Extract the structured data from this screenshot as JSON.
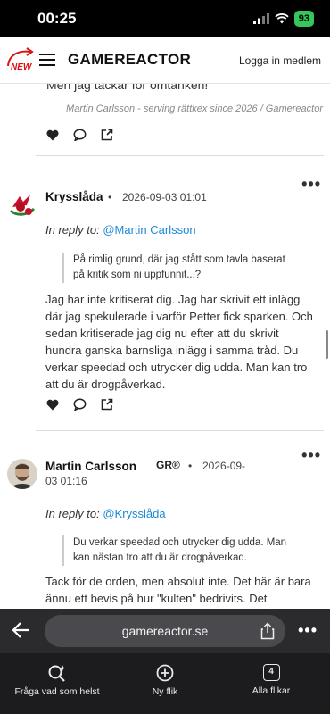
{
  "status_bar": {
    "time": "00:25",
    "battery": "93"
  },
  "header": {
    "badge": "NEW",
    "logo": "GAMEREACTOR",
    "login": "Logga in medlem"
  },
  "prev_post": {
    "partial_text": "Men jag tackar för omtanken!",
    "signature": "Martin Carlsson - serving rättkex since 2026 / Gamereactor"
  },
  "posts": [
    {
      "author": "Krysslåda",
      "separator": "•",
      "datetime": "2026-09-03 01:01",
      "reply_label": "In reply to:",
      "reply_mention": "@Martin Carlsson",
      "quote": "På rimlig grund, där jag stått som tavla baserat på kritik som ni uppfunnit...?",
      "body": "Jag har inte kritiserat dig. Jag har skrivit ett inlägg där jag spekulerade i varför Petter fick sparken. Och sedan kritiserade jag dig nu efter att du skrivit hundra ganska barnsliga inlägg i samma tråd. Du verkar speedad och utrycker dig udda. Man kan tro att du är drogpåverkad."
    },
    {
      "author": "Martin Carlsson",
      "badge": "GR®",
      "separator": "•",
      "datetime_line1": "2026-09-",
      "datetime_line2": "03 01:16",
      "reply_label": "In reply to:",
      "reply_mention": "@Krysslåda",
      "quote": "Du verkar speedad och utrycker dig udda. Man kan nästan tro att du är drogpåverkad.",
      "body": "Tack för de orden, men absolut inte. Det här är bara ännu ett bevis på hur \"kulten\" bedrivits. Det"
    }
  ],
  "browser": {
    "url": "gamereactor.se",
    "toolbar": [
      {
        "label": "Fråga vad som helst",
        "icon": "search-sparkle-icon"
      },
      {
        "label": "Ny flik",
        "icon": "plus-circle-icon"
      },
      {
        "label": "Alla flikar",
        "icon": "tabs-icon",
        "count": "4"
      }
    ]
  }
}
